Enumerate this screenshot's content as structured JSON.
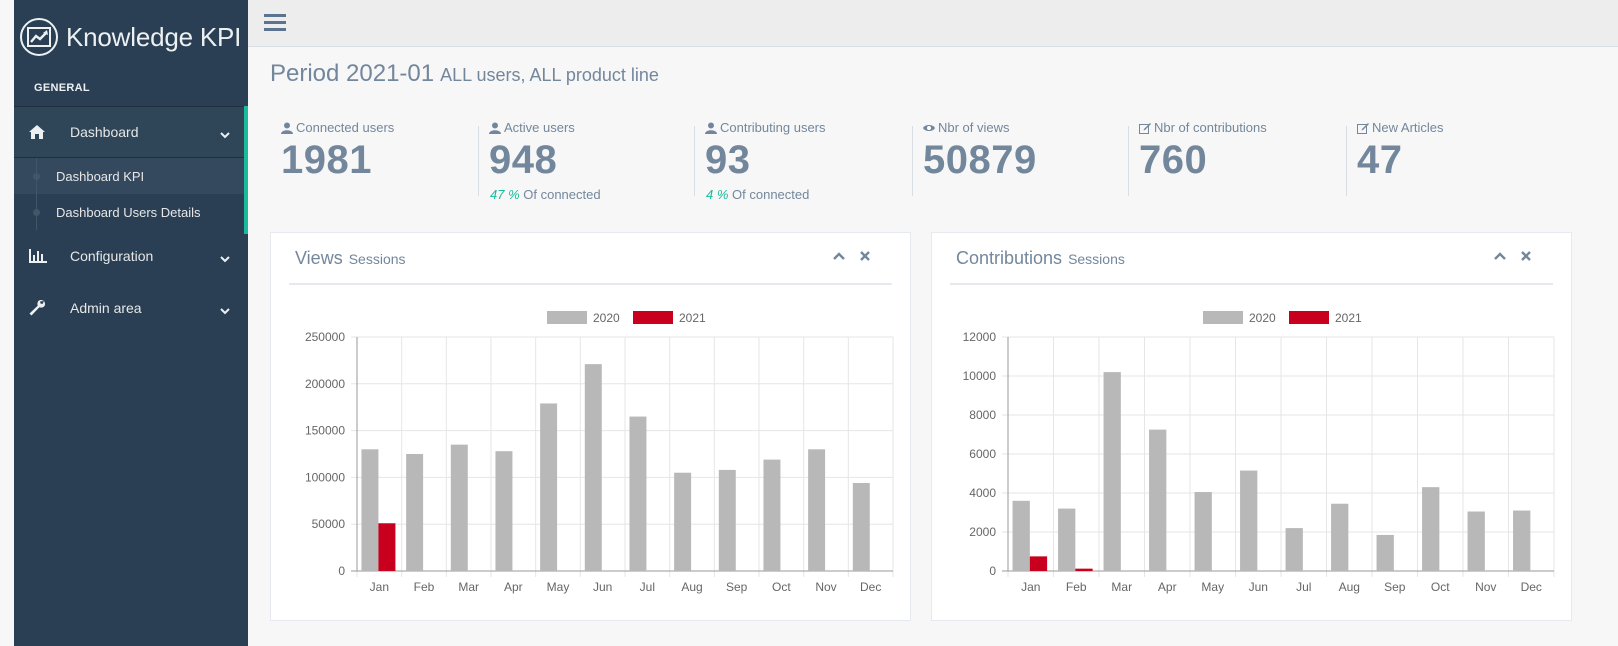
{
  "app": {
    "title": "Knowledge KPI"
  },
  "sidebar": {
    "section": "GENERAL",
    "items": [
      {
        "label": "Dashboard",
        "icon": "home-icon",
        "children": [
          {
            "label": "Dashboard KPI"
          },
          {
            "label": "Dashboard Users Details"
          }
        ]
      },
      {
        "label": "Configuration",
        "icon": "bar-chart-icon"
      },
      {
        "label": "Admin area",
        "icon": "wrench-icon"
      }
    ]
  },
  "period": {
    "title": "Period 2021-01",
    "subtitle": "ALL users, ALL product line"
  },
  "tiles": [
    {
      "label": "Connected users",
      "icon": "user-icon",
      "count": "1981"
    },
    {
      "label": "Active users",
      "icon": "user-icon",
      "count": "948",
      "pct": "47 %",
      "foot": " Of connected"
    },
    {
      "label": "Contributing users",
      "icon": "user-icon",
      "count": "93",
      "pct": "4 %",
      "foot": " Of connected"
    },
    {
      "label": "Nbr of views",
      "icon": "eye-icon",
      "count": "50879"
    },
    {
      "label": "Nbr of contributions",
      "icon": "edit-icon",
      "count": "760"
    },
    {
      "label": "New Articles",
      "icon": "edit-icon",
      "count": "47"
    }
  ],
  "colors": {
    "sidebar": "#2a3f54",
    "accent": "#1abb9c",
    "series2020": "#b8b8b8",
    "series2021": "#c8001e"
  },
  "panels": [
    {
      "title": "Views",
      "subtitle": "Sessions"
    },
    {
      "title": "Contributions",
      "subtitle": "Sessions"
    }
  ],
  "chart_data": [
    {
      "type": "bar",
      "title": "",
      "categories": [
        "Jan",
        "Feb",
        "Mar",
        "Apr",
        "May",
        "Jun",
        "Jul",
        "Aug",
        "Sep",
        "Oct",
        "Nov",
        "Dec"
      ],
      "series": [
        {
          "name": "2020",
          "values": [
            130000,
            125000,
            135000,
            128000,
            179000,
            221000,
            165000,
            105000,
            108000,
            119000,
            130000,
            94000
          ]
        },
        {
          "name": "2021",
          "values": [
            51000,
            null,
            null,
            null,
            null,
            null,
            null,
            null,
            null,
            null,
            null,
            null
          ]
        }
      ],
      "yticks": [
        "0",
        "50000",
        "100000",
        "150000",
        "200000",
        "250000"
      ],
      "ylim": [
        0,
        250000
      ],
      "legend": "top-center",
      "grid": true
    },
    {
      "type": "bar",
      "title": "",
      "categories": [
        "Jan",
        "Feb",
        "Mar",
        "Apr",
        "May",
        "Jun",
        "Jul",
        "Aug",
        "Sep",
        "Oct",
        "Nov",
        "Dec"
      ],
      "series": [
        {
          "name": "2020",
          "values": [
            3600,
            3200,
            10200,
            7250,
            4050,
            5150,
            2200,
            3450,
            1850,
            4300,
            3050,
            3100
          ]
        },
        {
          "name": "2021",
          "values": [
            750,
            120,
            null,
            null,
            null,
            null,
            null,
            null,
            null,
            null,
            null,
            null
          ]
        }
      ],
      "yticks": [
        "0",
        "2000",
        "4000",
        "6000",
        "8000",
        "10000",
        "12000"
      ],
      "ylim": [
        0,
        12000
      ],
      "legend": "top-center",
      "grid": true
    }
  ]
}
